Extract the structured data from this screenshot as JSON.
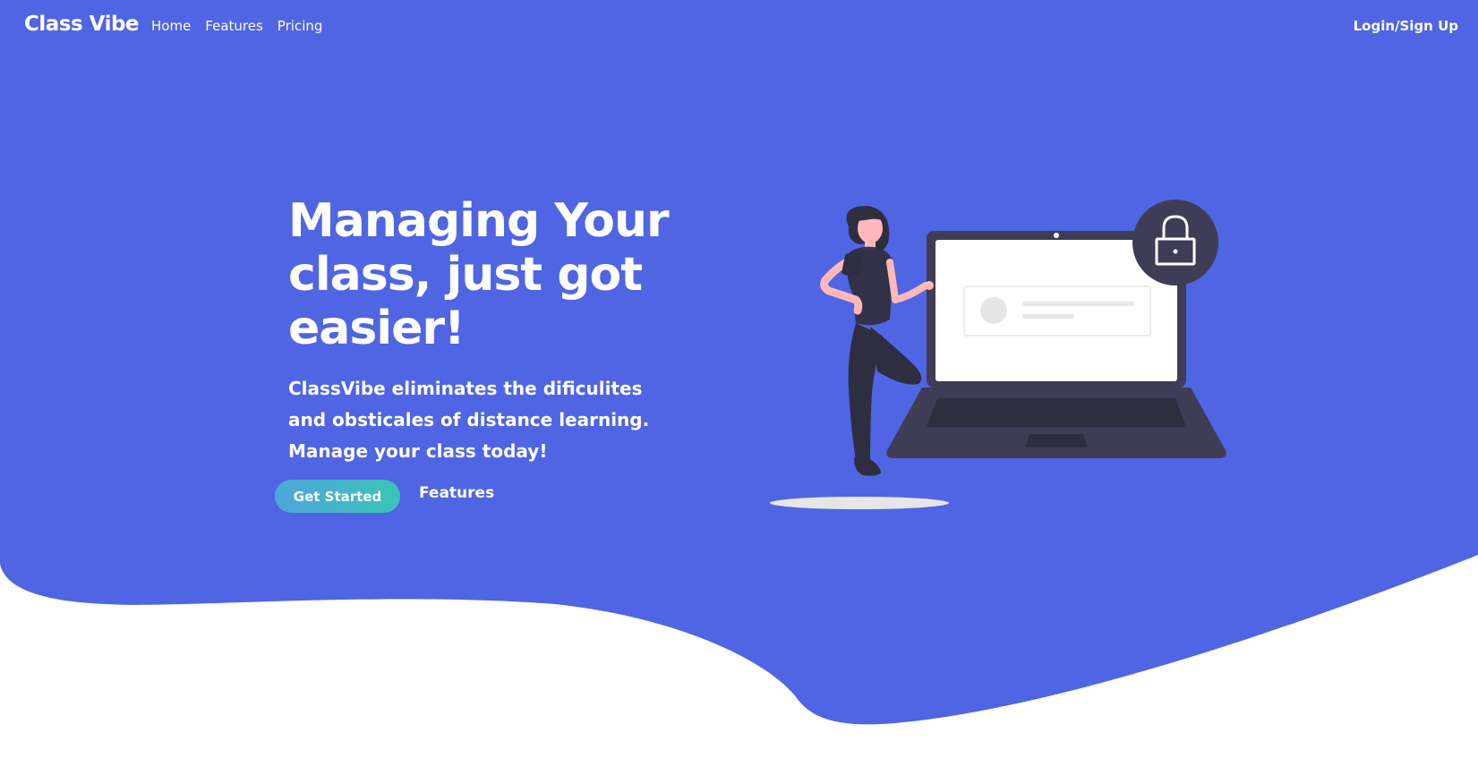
{
  "nav": {
    "brand": "Class Vibe",
    "links": [
      "Home",
      "Features",
      "Pricing"
    ],
    "login_label": "Login/Sign Up"
  },
  "hero": {
    "title": "Managing Your class, just got easier!",
    "subtitle": "ClassVibe eliminates the dificulites and obsticales of distance learning. Manage your class today!",
    "primary_button": "Get Started",
    "secondary_link": "Features"
  },
  "illustration": {
    "description_icons": [
      "person-icon",
      "laptop-icon",
      "lock-icon"
    ]
  },
  "colors": {
    "hero_background": "#4f65e3",
    "page_background": "#ffffff",
    "button_gradient_start": "#4ea6dc",
    "button_gradient_end": "#3bc4b6",
    "text": "#ffffff"
  }
}
